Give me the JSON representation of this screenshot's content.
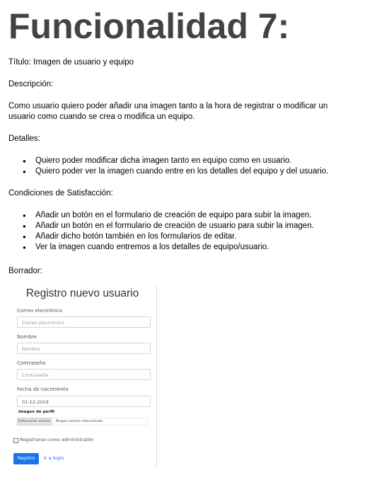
{
  "heading": "Funcionalidad 7:",
  "titulo": "Título: Imagen de usuario y equipo",
  "descripcion_label": "Descripción:",
  "descripcion_texto": "Como usuario quiero poder añadir una imagen tanto a la hora de registrar o modificar un usuario como cuando se crea o modifica un equipo.",
  "detalles_label": "Detalles:",
  "detalles": [
    "Quiero poder modificar dicha imagen tanto en equipo como en usuario.",
    "Quiero poder ver la imagen cuando entre en los detalles del equipo y del usuario."
  ],
  "condiciones_label": "Condiciones de Satisfacción:",
  "condiciones": [
    "Añadir un botón en el formulario de creación de equipo para subir la imagen.",
    "Añadir un botón en el formulario de creación de usuario para subir la imagen.",
    "Añadir dicho botón también en los formularios de editar.",
    "Ver la imagen cuando entremos a los detalles de equipo/usuario."
  ],
  "borrador_label": "Borrador:",
  "mockup": {
    "title": "Registro nuevo usuario",
    "email_label": "Correo electrónico",
    "email_placeholder": "Correo electrónico",
    "name_label": "Nombre",
    "name_placeholder": "Nombre",
    "password_label": "Contraseña",
    "password_placeholder": "Contraseña",
    "birth_label": "Fecha de nacimiento",
    "birth_value": "01-12-2019",
    "image_label": "Imagen de perfil",
    "file_button": "Seleccionar archivo",
    "file_name": "Ningún archivo seleccionado",
    "admin_label": "Registrarse como administrador",
    "submit_label": "Registro",
    "login_link": "Ir a login"
  }
}
